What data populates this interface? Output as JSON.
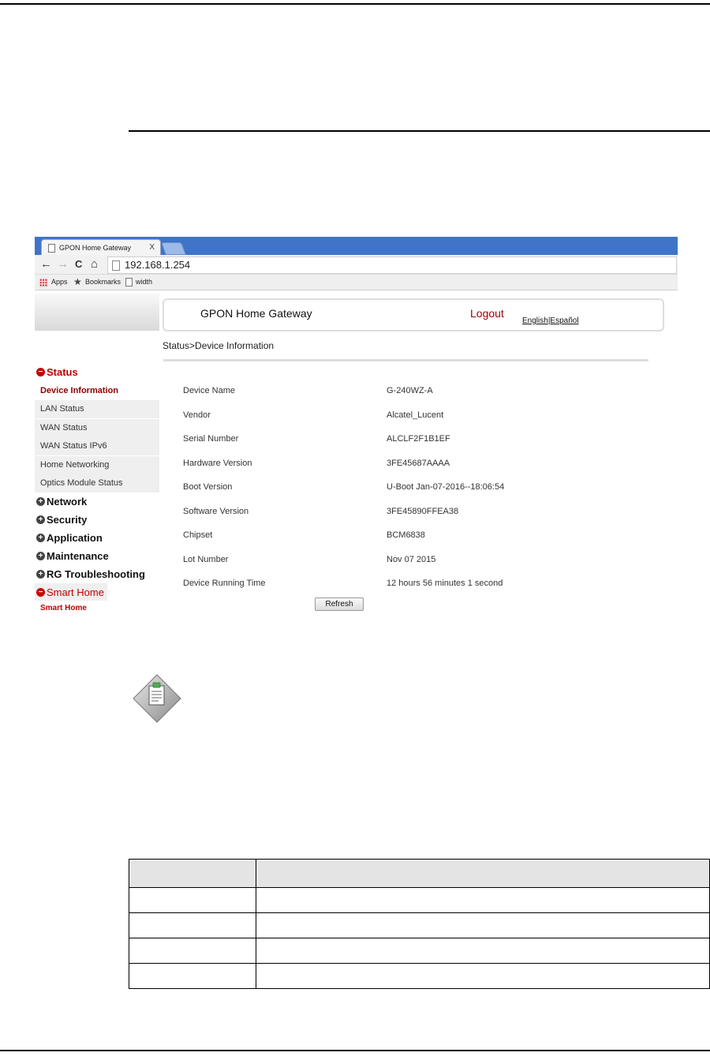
{
  "browser": {
    "tab_title": "GPON Home Gateway",
    "tab_close": "X",
    "nav": {
      "back": "←",
      "forward": "→",
      "reload": "C",
      "home": "⌂"
    },
    "url": "192.168.1.254",
    "bookmarks": [
      "Apps",
      "Bookmarks",
      "width"
    ]
  },
  "header": {
    "title": "GPON Home Gateway",
    "logout": "Logout",
    "lang_english": "English",
    "lang_separator": "|",
    "lang_espanol": "Español"
  },
  "breadcrumb": "Status>Device Information",
  "sidebar": {
    "status": "Status",
    "status_items": [
      "Device Information",
      "LAN Status",
      "WAN Status",
      "WAN Status IPv6",
      "Home Networking",
      "Optics Module Status"
    ],
    "network": "Network",
    "security": "Security",
    "application": "Application",
    "maintenance": "Maintenance",
    "rg_troubleshooting": "RG Troubleshooting",
    "smart_home": "Smart Home",
    "smart_home_items": [
      "Smart Home"
    ]
  },
  "device_info": [
    {
      "label": "Device Name",
      "value": "G-240WZ-A"
    },
    {
      "label": "Vendor",
      "value": "Alcatel_Lucent"
    },
    {
      "label": "Serial Number",
      "value": "ALCLF2F1B1EF"
    },
    {
      "label": "Hardware Version",
      "value": "3FE45687AAAA"
    },
    {
      "label": "Boot Version",
      "value": "U-Boot Jan-07-2016--18:06:54"
    },
    {
      "label": "Software Version",
      "value": "3FE45890FFEA38"
    },
    {
      "label": "Chipset",
      "value": "BCM6838"
    },
    {
      "label": "Lot Number",
      "value": "Nov 07 2015"
    },
    {
      "label": "Device Running Time",
      "value": "12 hours 56 minutes 1 second"
    }
  ],
  "refresh_label": "Refresh",
  "colors": {
    "accent_red": "#c00000",
    "tab_strip": "#3f74c9"
  }
}
